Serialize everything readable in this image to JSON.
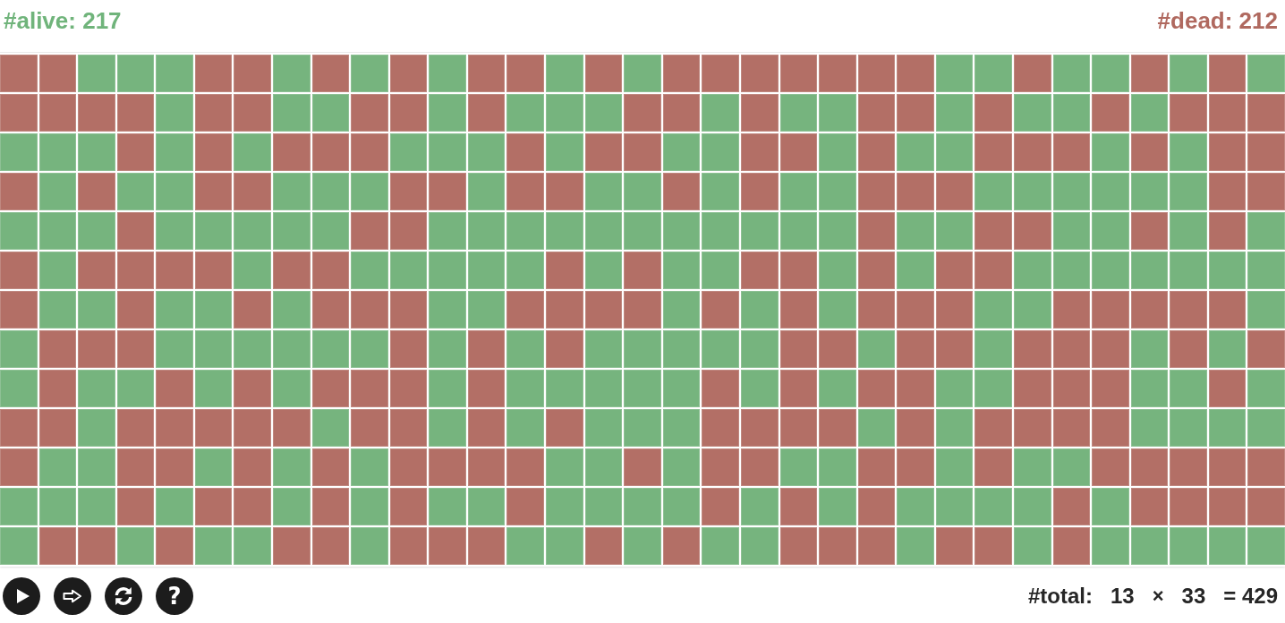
{
  "header": {
    "alive": "#alive: 217",
    "dead": "#dead: 212"
  },
  "grid": {
    "rows": [
      {
        "cells": [
          {
            "alive": false
          },
          {
            "alive": false
          },
          {
            "alive": true
          },
          {
            "alive": true
          },
          {
            "alive": true
          },
          {
            "alive": false
          },
          {
            "alive": false
          },
          {
            "alive": true
          },
          {
            "alive": false
          },
          {
            "alive": true
          },
          {
            "alive": false
          },
          {
            "alive": true
          },
          {
            "alive": false
          },
          {
            "alive": false
          },
          {
            "alive": true
          },
          {
            "alive": false
          },
          {
            "alive": true
          },
          {
            "alive": false
          },
          {
            "alive": false
          },
          {
            "alive": false
          },
          {
            "alive": false
          },
          {
            "alive": false
          },
          {
            "alive": false
          },
          {
            "alive": false
          },
          {
            "alive": true
          },
          {
            "alive": true
          },
          {
            "alive": false
          },
          {
            "alive": true
          },
          {
            "alive": true
          },
          {
            "alive": false
          },
          {
            "alive": true
          },
          {
            "alive": false
          },
          {
            "alive": true
          }
        ]
      },
      {
        "cells": [
          {
            "alive": false
          },
          {
            "alive": false
          },
          {
            "alive": false
          },
          {
            "alive": false
          },
          {
            "alive": true
          },
          {
            "alive": false
          },
          {
            "alive": false
          },
          {
            "alive": true
          },
          {
            "alive": true
          },
          {
            "alive": false
          },
          {
            "alive": false
          },
          {
            "alive": true
          },
          {
            "alive": false
          },
          {
            "alive": true
          },
          {
            "alive": true
          },
          {
            "alive": true
          },
          {
            "alive": false
          },
          {
            "alive": false
          },
          {
            "alive": true
          },
          {
            "alive": false
          },
          {
            "alive": true
          },
          {
            "alive": true
          },
          {
            "alive": false
          },
          {
            "alive": false
          },
          {
            "alive": true
          },
          {
            "alive": false
          },
          {
            "alive": true
          },
          {
            "alive": true
          },
          {
            "alive": false
          },
          {
            "alive": true
          },
          {
            "alive": false
          },
          {
            "alive": false
          },
          {
            "alive": false
          }
        ]
      },
      {
        "cells": [
          {
            "alive": true
          },
          {
            "alive": true
          },
          {
            "alive": true
          },
          {
            "alive": false
          },
          {
            "alive": true
          },
          {
            "alive": false
          },
          {
            "alive": true
          },
          {
            "alive": false
          },
          {
            "alive": false
          },
          {
            "alive": false
          },
          {
            "alive": true
          },
          {
            "alive": true
          },
          {
            "alive": true
          },
          {
            "alive": false
          },
          {
            "alive": true
          },
          {
            "alive": false
          },
          {
            "alive": false
          },
          {
            "alive": true
          },
          {
            "alive": true
          },
          {
            "alive": false
          },
          {
            "alive": false
          },
          {
            "alive": true
          },
          {
            "alive": false
          },
          {
            "alive": true
          },
          {
            "alive": true
          },
          {
            "alive": false
          },
          {
            "alive": false
          },
          {
            "alive": false
          },
          {
            "alive": true
          },
          {
            "alive": false
          },
          {
            "alive": true
          },
          {
            "alive": false
          },
          {
            "alive": false
          }
        ]
      },
      {
        "cells": [
          {
            "alive": false
          },
          {
            "alive": true
          },
          {
            "alive": false
          },
          {
            "alive": true
          },
          {
            "alive": true
          },
          {
            "alive": false
          },
          {
            "alive": false
          },
          {
            "alive": true
          },
          {
            "alive": true
          },
          {
            "alive": true
          },
          {
            "alive": false
          },
          {
            "alive": false
          },
          {
            "alive": true
          },
          {
            "alive": false
          },
          {
            "alive": false
          },
          {
            "alive": true
          },
          {
            "alive": true
          },
          {
            "alive": false
          },
          {
            "alive": true
          },
          {
            "alive": false
          },
          {
            "alive": true
          },
          {
            "alive": true
          },
          {
            "alive": false
          },
          {
            "alive": false
          },
          {
            "alive": false
          },
          {
            "alive": true
          },
          {
            "alive": true
          },
          {
            "alive": true
          },
          {
            "alive": true
          },
          {
            "alive": true
          },
          {
            "alive": true
          },
          {
            "alive": false
          },
          {
            "alive": false
          }
        ]
      },
      {
        "cells": [
          {
            "alive": true
          },
          {
            "alive": true
          },
          {
            "alive": true
          },
          {
            "alive": false
          },
          {
            "alive": true
          },
          {
            "alive": true
          },
          {
            "alive": true
          },
          {
            "alive": true
          },
          {
            "alive": true
          },
          {
            "alive": false
          },
          {
            "alive": false
          },
          {
            "alive": true
          },
          {
            "alive": true
          },
          {
            "alive": true
          },
          {
            "alive": true
          },
          {
            "alive": true
          },
          {
            "alive": true
          },
          {
            "alive": true
          },
          {
            "alive": true
          },
          {
            "alive": true
          },
          {
            "alive": true
          },
          {
            "alive": true
          },
          {
            "alive": false
          },
          {
            "alive": true
          },
          {
            "alive": true
          },
          {
            "alive": false
          },
          {
            "alive": false
          },
          {
            "alive": true
          },
          {
            "alive": true
          },
          {
            "alive": false
          },
          {
            "alive": true
          },
          {
            "alive": false
          },
          {
            "alive": true
          }
        ]
      },
      {
        "cells": [
          {
            "alive": false
          },
          {
            "alive": true
          },
          {
            "alive": false
          },
          {
            "alive": false
          },
          {
            "alive": false
          },
          {
            "alive": false
          },
          {
            "alive": true
          },
          {
            "alive": false
          },
          {
            "alive": false
          },
          {
            "alive": true
          },
          {
            "alive": true
          },
          {
            "alive": true
          },
          {
            "alive": true
          },
          {
            "alive": true
          },
          {
            "alive": false
          },
          {
            "alive": true
          },
          {
            "alive": false
          },
          {
            "alive": true
          },
          {
            "alive": true
          },
          {
            "alive": false
          },
          {
            "alive": false
          },
          {
            "alive": true
          },
          {
            "alive": false
          },
          {
            "alive": true
          },
          {
            "alive": false
          },
          {
            "alive": false
          },
          {
            "alive": true
          },
          {
            "alive": true
          },
          {
            "alive": true
          },
          {
            "alive": true
          },
          {
            "alive": true
          },
          {
            "alive": true
          },
          {
            "alive": true
          }
        ]
      },
      {
        "cells": [
          {
            "alive": false
          },
          {
            "alive": true
          },
          {
            "alive": true
          },
          {
            "alive": false
          },
          {
            "alive": true
          },
          {
            "alive": true
          },
          {
            "alive": false
          },
          {
            "alive": true
          },
          {
            "alive": false
          },
          {
            "alive": false
          },
          {
            "alive": false
          },
          {
            "alive": true
          },
          {
            "alive": true
          },
          {
            "alive": false
          },
          {
            "alive": false
          },
          {
            "alive": false
          },
          {
            "alive": false
          },
          {
            "alive": true
          },
          {
            "alive": false
          },
          {
            "alive": true
          },
          {
            "alive": false
          },
          {
            "alive": true
          },
          {
            "alive": false
          },
          {
            "alive": false
          },
          {
            "alive": false
          },
          {
            "alive": true
          },
          {
            "alive": true
          },
          {
            "alive": false
          },
          {
            "alive": false
          },
          {
            "alive": false
          },
          {
            "alive": false
          },
          {
            "alive": false
          },
          {
            "alive": true
          }
        ]
      },
      {
        "cells": [
          {
            "alive": true
          },
          {
            "alive": false
          },
          {
            "alive": false
          },
          {
            "alive": false
          },
          {
            "alive": true
          },
          {
            "alive": true
          },
          {
            "alive": true
          },
          {
            "alive": true
          },
          {
            "alive": true
          },
          {
            "alive": true
          },
          {
            "alive": false
          },
          {
            "alive": true
          },
          {
            "alive": false
          },
          {
            "alive": true
          },
          {
            "alive": false
          },
          {
            "alive": true
          },
          {
            "alive": true
          },
          {
            "alive": true
          },
          {
            "alive": true
          },
          {
            "alive": true
          },
          {
            "alive": false
          },
          {
            "alive": false
          },
          {
            "alive": true
          },
          {
            "alive": false
          },
          {
            "alive": false
          },
          {
            "alive": true
          },
          {
            "alive": false
          },
          {
            "alive": false
          },
          {
            "alive": false
          },
          {
            "alive": true
          },
          {
            "alive": false
          },
          {
            "alive": true
          },
          {
            "alive": false
          }
        ]
      },
      {
        "cells": [
          {
            "alive": true
          },
          {
            "alive": false
          },
          {
            "alive": true
          },
          {
            "alive": true
          },
          {
            "alive": false
          },
          {
            "alive": true
          },
          {
            "alive": false
          },
          {
            "alive": true
          },
          {
            "alive": false
          },
          {
            "alive": false
          },
          {
            "alive": false
          },
          {
            "alive": true
          },
          {
            "alive": false
          },
          {
            "alive": true
          },
          {
            "alive": true
          },
          {
            "alive": true
          },
          {
            "alive": true
          },
          {
            "alive": true
          },
          {
            "alive": false
          },
          {
            "alive": true
          },
          {
            "alive": false
          },
          {
            "alive": true
          },
          {
            "alive": false
          },
          {
            "alive": false
          },
          {
            "alive": true
          },
          {
            "alive": true
          },
          {
            "alive": false
          },
          {
            "alive": false
          },
          {
            "alive": false
          },
          {
            "alive": true
          },
          {
            "alive": true
          },
          {
            "alive": false
          },
          {
            "alive": true
          }
        ]
      },
      {
        "cells": [
          {
            "alive": false
          },
          {
            "alive": false
          },
          {
            "alive": true
          },
          {
            "alive": false
          },
          {
            "alive": false
          },
          {
            "alive": false
          },
          {
            "alive": false
          },
          {
            "alive": false
          },
          {
            "alive": true
          },
          {
            "alive": false
          },
          {
            "alive": false
          },
          {
            "alive": true
          },
          {
            "alive": false
          },
          {
            "alive": true
          },
          {
            "alive": false
          },
          {
            "alive": true
          },
          {
            "alive": true
          },
          {
            "alive": true
          },
          {
            "alive": false
          },
          {
            "alive": false
          },
          {
            "alive": false
          },
          {
            "alive": false
          },
          {
            "alive": true
          },
          {
            "alive": false
          },
          {
            "alive": true
          },
          {
            "alive": false
          },
          {
            "alive": false
          },
          {
            "alive": false
          },
          {
            "alive": false
          },
          {
            "alive": true
          },
          {
            "alive": true
          },
          {
            "alive": true
          },
          {
            "alive": true
          }
        ]
      },
      {
        "cells": [
          {
            "alive": false
          },
          {
            "alive": true
          },
          {
            "alive": true
          },
          {
            "alive": false
          },
          {
            "alive": false
          },
          {
            "alive": true
          },
          {
            "alive": false
          },
          {
            "alive": true
          },
          {
            "alive": false
          },
          {
            "alive": true
          },
          {
            "alive": false
          },
          {
            "alive": false
          },
          {
            "alive": false
          },
          {
            "alive": false
          },
          {
            "alive": true
          },
          {
            "alive": true
          },
          {
            "alive": false
          },
          {
            "alive": true
          },
          {
            "alive": false
          },
          {
            "alive": false
          },
          {
            "alive": true
          },
          {
            "alive": true
          },
          {
            "alive": false
          },
          {
            "alive": false
          },
          {
            "alive": true
          },
          {
            "alive": false
          },
          {
            "alive": true
          },
          {
            "alive": true
          },
          {
            "alive": false
          },
          {
            "alive": false
          },
          {
            "alive": false
          },
          {
            "alive": false
          },
          {
            "alive": false
          }
        ]
      },
      {
        "cells": [
          {
            "alive": true
          },
          {
            "alive": true
          },
          {
            "alive": true
          },
          {
            "alive": false
          },
          {
            "alive": true
          },
          {
            "alive": false
          },
          {
            "alive": false
          },
          {
            "alive": true
          },
          {
            "alive": false
          },
          {
            "alive": true
          },
          {
            "alive": false
          },
          {
            "alive": true
          },
          {
            "alive": true
          },
          {
            "alive": false
          },
          {
            "alive": true
          },
          {
            "alive": true
          },
          {
            "alive": true
          },
          {
            "alive": true
          },
          {
            "alive": false
          },
          {
            "alive": true
          },
          {
            "alive": false
          },
          {
            "alive": true
          },
          {
            "alive": false
          },
          {
            "alive": true
          },
          {
            "alive": true
          },
          {
            "alive": true
          },
          {
            "alive": true
          },
          {
            "alive": false
          },
          {
            "alive": true
          },
          {
            "alive": false
          },
          {
            "alive": false
          },
          {
            "alive": false
          },
          {
            "alive": false
          }
        ]
      },
      {
        "cells": [
          {
            "alive": true
          },
          {
            "alive": false
          },
          {
            "alive": false
          },
          {
            "alive": true
          },
          {
            "alive": false
          },
          {
            "alive": true
          },
          {
            "alive": true
          },
          {
            "alive": false
          },
          {
            "alive": false
          },
          {
            "alive": true
          },
          {
            "alive": false
          },
          {
            "alive": false
          },
          {
            "alive": false
          },
          {
            "alive": true
          },
          {
            "alive": true
          },
          {
            "alive": false
          },
          {
            "alive": true
          },
          {
            "alive": false
          },
          {
            "alive": true
          },
          {
            "alive": true
          },
          {
            "alive": false
          },
          {
            "alive": false
          },
          {
            "alive": false
          },
          {
            "alive": true
          },
          {
            "alive": false
          },
          {
            "alive": false
          },
          {
            "alive": true
          },
          {
            "alive": false
          },
          {
            "alive": true
          },
          {
            "alive": true
          },
          {
            "alive": true
          },
          {
            "alive": true
          },
          {
            "alive": true
          }
        ]
      }
    ]
  },
  "controls": [
    {
      "kind": "play"
    },
    {
      "kind": "step"
    },
    {
      "kind": "reset"
    },
    {
      "kind": "help",
      "label": "?"
    }
  ],
  "total": {
    "label": "#total:",
    "rows": "13",
    "times": "×",
    "columns": "33",
    "result": "= 429"
  }
}
